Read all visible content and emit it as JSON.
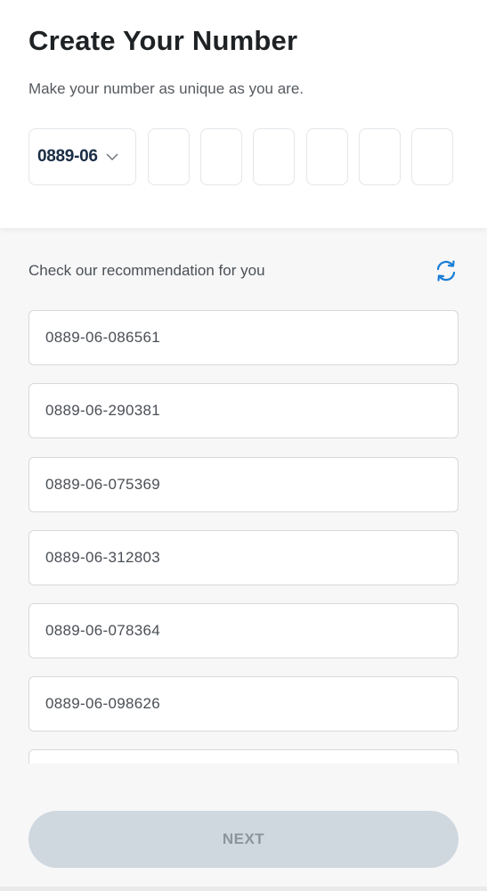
{
  "header": {
    "title": "Create Your Number",
    "subtitle": "Make your number as unique as you are."
  },
  "number_builder": {
    "prefix": "0889-06",
    "prefix_icon": "chevron-down-icon",
    "digits": [
      "",
      "",
      "",
      "",
      "",
      ""
    ]
  },
  "recommendations": {
    "label": "Check our recommendation for you",
    "refresh_icon": "refresh-icon",
    "accent_color": "#1a7fd6",
    "items": [
      "0889-06-086561",
      "0889-06-290381",
      "0889-06-075369",
      "0889-06-312803",
      "0889-06-078364",
      "0889-06-098626",
      ""
    ]
  },
  "footer": {
    "next_label": "NEXT"
  }
}
